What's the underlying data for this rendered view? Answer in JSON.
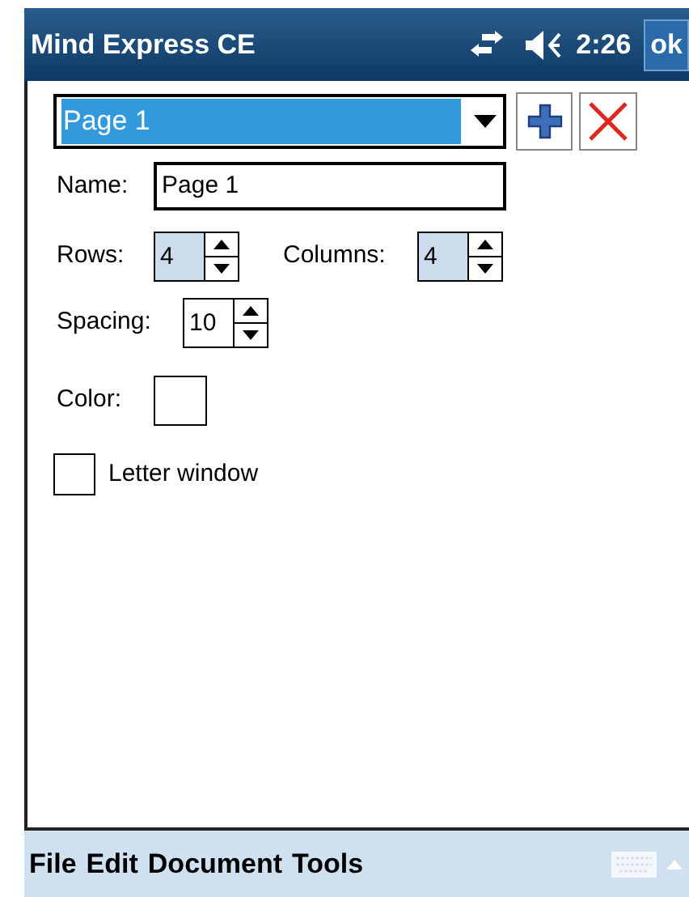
{
  "title_bar": {
    "title": "Mind Express CE",
    "clock": "2:26",
    "ok_button": "ok"
  },
  "page_select": {
    "value": "Page 1",
    "selected": true
  },
  "name_field": {
    "label": "Name:",
    "value": "Page 1"
  },
  "spinners": [
    {
      "label": "Rows:",
      "value": "4",
      "highlighted": true
    },
    {
      "label": "Columns:",
      "value": "4",
      "highlighted": true
    },
    {
      "label": "Spacing:",
      "value": "10",
      "highlighted": false
    }
  ],
  "color_field": {
    "label": "Color:",
    "color": "#ffffff"
  },
  "letter_window": {
    "label": "Letter window",
    "checked": false
  },
  "menu_bar": [
    "File",
    "Edit",
    "Document",
    "Tools"
  ]
}
